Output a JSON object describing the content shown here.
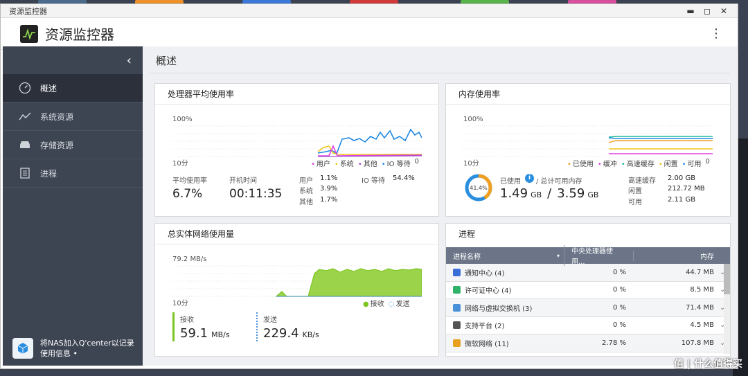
{
  "window": {
    "title": "资源监控器"
  },
  "app": {
    "title": "资源监控器"
  },
  "sidebar": {
    "items": [
      {
        "label": "概述",
        "icon": "gauge-icon"
      },
      {
        "label": "系统资源",
        "icon": "chart-line-icon"
      },
      {
        "label": "存储资源",
        "icon": "drive-icon"
      },
      {
        "label": "进程",
        "icon": "list-icon"
      }
    ],
    "qcenter": {
      "line1": "将NAS加入Q'center以记录",
      "line2": "使用信息 •"
    }
  },
  "main": {
    "title": "概述"
  },
  "cpu": {
    "title": "处理器平均使用率",
    "ymax": "100%",
    "xlabel": "10分",
    "legend": [
      "用户",
      "系统",
      "其他",
      "IO 等待"
    ],
    "legend_end": "0",
    "avg_label": "平均使用率",
    "avg_value": "6.7%",
    "uptime_label": "开机时间",
    "uptime_value": "00:11:35",
    "user_label": "用户",
    "user_value": "1.1%",
    "sys_label": "系统",
    "sys_value": "3.9%",
    "other_label": "其他",
    "other_value": "1.7%",
    "io_label": "IO 等待",
    "io_value": "54.4%",
    "colors": {
      "user": "#e040e0",
      "sys": "#f0c419",
      "other": "#9c4dcc",
      "io": "#1e88e5"
    }
  },
  "memory": {
    "title": "内存使用率",
    "ymax": "100%",
    "xlabel": "10分",
    "legend": [
      "已使用",
      "缓冲",
      "高速缓存",
      "闲置",
      "可用"
    ],
    "legend_end": "0",
    "donut_pct": "41.4%",
    "used_label": "已使用",
    "total_label": "/ 总计可用内存",
    "used_value": "1.49",
    "used_unit": "GB",
    "slash": "/",
    "total_value": "3.59",
    "total_unit": "GB",
    "cache_label": "高速缓存",
    "cache_value": "2.00 GB",
    "idle_label": "闲置",
    "idle_value": "212.72 MB",
    "avail_label": "可用",
    "avail_value": "2.11 GB",
    "used_fraction": 0.414
  },
  "network": {
    "title": "总实体网络使用量",
    "ymax": "79.2 MB/s",
    "xlabel": "10分",
    "legend": [
      "接收",
      "发送"
    ],
    "recv_label": "接收",
    "recv_value": "59.1",
    "recv_unit": "MB/s",
    "send_label": "发送",
    "send_value": "229.4",
    "send_unit": "KB/s",
    "colors": {
      "recv": "#7cc520",
      "send": "#4a90d9"
    }
  },
  "process": {
    "title": "进程",
    "headers": [
      "进程名称",
      "中央处理器使用...",
      "内存"
    ],
    "rows": [
      {
        "name": "通知中心 (4)",
        "cpu": "0 %",
        "mem": "44.7 MB",
        "icon": "notification-icon",
        "color": "#3a6fd8"
      },
      {
        "name": "许可证中心 (4)",
        "cpu": "0 %",
        "mem": "8.5 MB",
        "icon": "license-icon",
        "color": "#2fb36b"
      },
      {
        "name": "网络与虚拟交换机 (3)",
        "cpu": "0 %",
        "mem": "71.4 MB",
        "icon": "network-switch-icon",
        "color": "#4a90d9"
      },
      {
        "name": "支持平台 (2)",
        "cpu": "0 %",
        "mem": "4.5 MB",
        "icon": "support-icon",
        "color": "#555555"
      },
      {
        "name": "微软网络 (11)",
        "cpu": "2.78 %",
        "mem": "107.8 MB",
        "icon": "microsoft-network-icon",
        "color": "#e8a020"
      }
    ]
  },
  "watermark": "值 | 什么值得买"
}
